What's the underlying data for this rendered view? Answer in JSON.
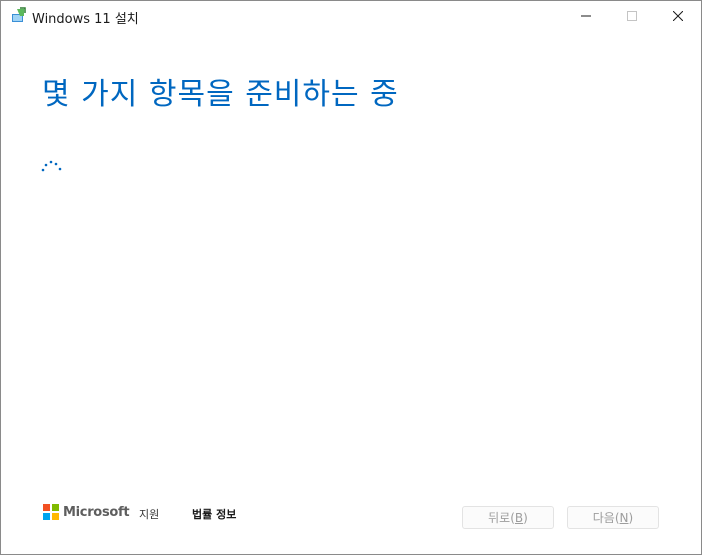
{
  "window": {
    "title": "Windows 11 설치"
  },
  "main": {
    "heading": "몇 가지 항목을 준비하는 중"
  },
  "footer": {
    "brand": "Microsoft",
    "support_label": "지원",
    "legal_label": "법률 정보",
    "back_label": "뒤로",
    "back_accel": "B",
    "next_label": "다음",
    "next_accel": "N"
  },
  "colors": {
    "accent": "#0067c0",
    "ms_red": "#f25022",
    "ms_green": "#7fba00",
    "ms_blue": "#00a4ef",
    "ms_yellow": "#ffb900"
  }
}
